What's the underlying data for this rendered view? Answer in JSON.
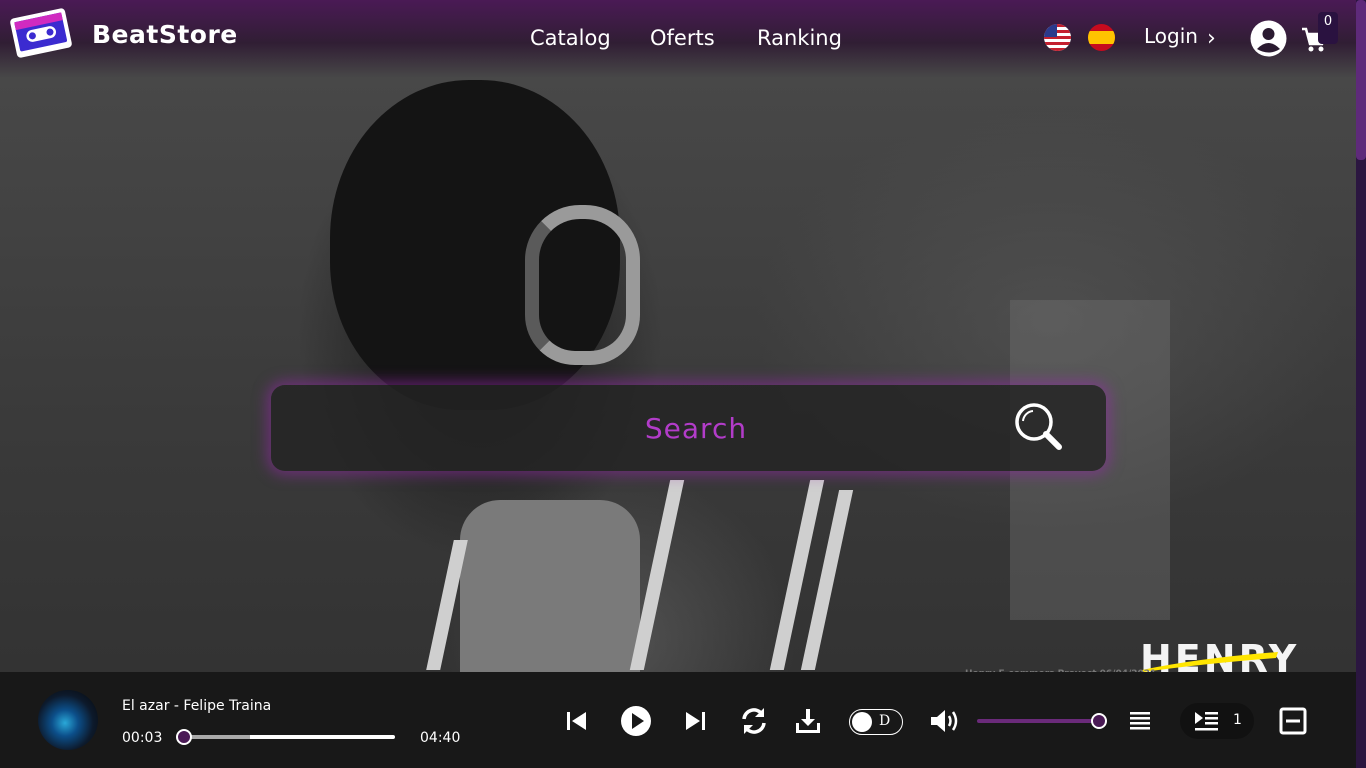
{
  "header": {
    "brand": "BeatStore",
    "nav": [
      "Catalog",
      "Oferts",
      "Ranking"
    ],
    "languages": [
      "en-us-flag",
      "es-flag"
    ],
    "login_label": "Login",
    "cart_count": "0"
  },
  "search": {
    "placeholder": "Search"
  },
  "watermark": {
    "logo_text": "HENRY",
    "credit": "Henry E-commers Proyect 06/04/2021"
  },
  "player": {
    "track": "El azar - Felipe Traina",
    "elapsed": "00:03",
    "duration": "04:40",
    "progress": 0.0,
    "mode_letter": "D",
    "volume": 1.0,
    "queue_count": "1"
  },
  "colors": {
    "accent": "#b23cc9",
    "topbar": "#4a1a55",
    "player_bg": "#181818"
  }
}
